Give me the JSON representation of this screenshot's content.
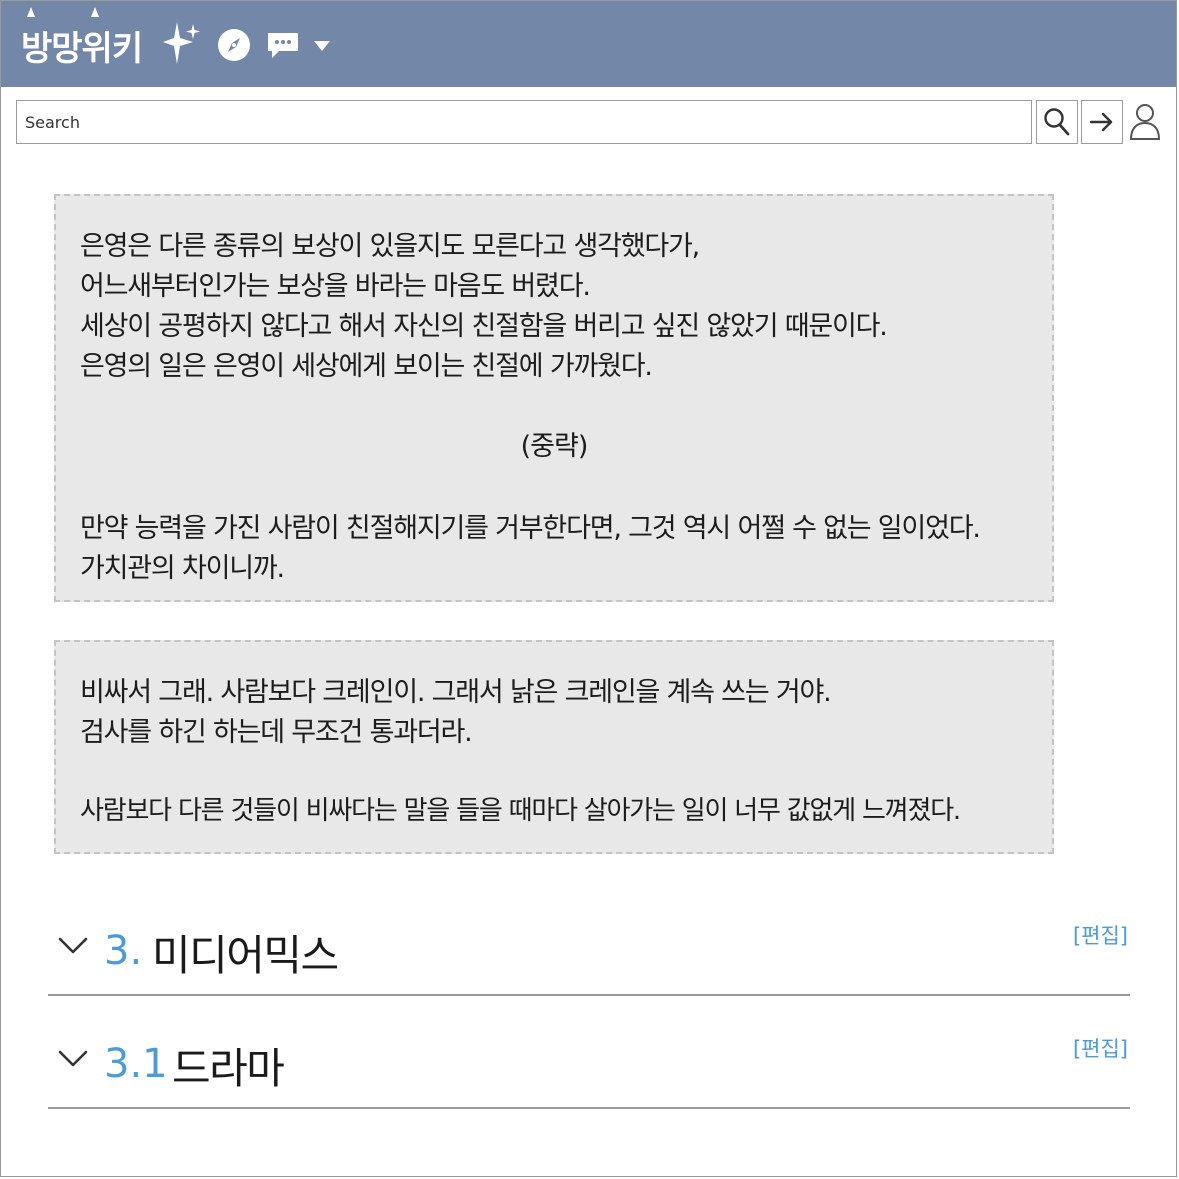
{
  "header": {
    "logo_text": "방망위키",
    "background_color": "#7387a8",
    "icons": [
      "sparkle-icon",
      "compass-icon",
      "chat-icon",
      "chevron-down-icon"
    ]
  },
  "search": {
    "placeholder": "Search",
    "buttons": [
      "search-icon",
      "arrow-right-icon",
      "user-icon"
    ]
  },
  "quotes": [
    {
      "lines": [
        "은영은 다른 종류의 보상이 있을지도 모른다고 생각했다가,",
        "어느새부터인가는 보상을 바라는 마음도 버렸다.",
        "세상이 공평하지 않다고 해서 자신의 친절함을 버리고 싶진 않았기 때문이다.",
        "은영의 일은 은영이 세상에게 보이는 친절에 가까웠다."
      ],
      "center": "(중략)",
      "lines_after": [
        "만약 능력을 가진 사람이 친절해지기를 거부한다면, 그것 역시 어쩔 수 없는 일이었다.",
        "가치관의 차이니까."
      ]
    },
    {
      "lines": [
        "비싸서 그래. 사람보다 크레인이. 그래서 낡은 크레인을 계속 쓰는 거야.",
        "검사를 하긴 하는데 무조건 통과더라."
      ],
      "lines_after": [
        " 사람보다 다른 것들이 비싸다는 말을 들을 때마다 살아가는 일이 너무 값없게 느껴졌다."
      ]
    }
  ],
  "sections": [
    {
      "number": "3.",
      "title": "미디어믹스",
      "edit_label": "[편집]"
    },
    {
      "number": "3.1",
      "title": "드라마",
      "edit_label": "[편집]"
    }
  ],
  "colors": {
    "accent": "#4a9bd8",
    "quote_bg": "#e8e8e8"
  }
}
